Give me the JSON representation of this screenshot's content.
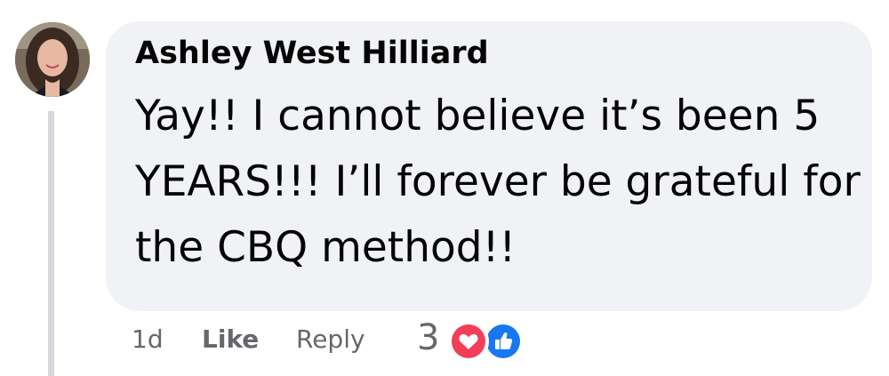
{
  "comment": {
    "author": "Ashley West Hilliard",
    "text": "Yay!! I cannot believe it’s been 5 YEARS!!! I’ll forever be grateful for the CBQ method!!",
    "avatar_icon": "profile-photo",
    "time": "1d",
    "like_label": "Like",
    "reply_label": "Reply",
    "reaction_count": "3",
    "reactions": [
      "love-icon",
      "like-thumb-icon"
    ]
  },
  "colors": {
    "bubble": "#f0f2f5",
    "text": "#050505",
    "meta": "#65676b",
    "love": "#f33e58",
    "like": "#1877f2",
    "thread_line": "#d5d7db"
  }
}
